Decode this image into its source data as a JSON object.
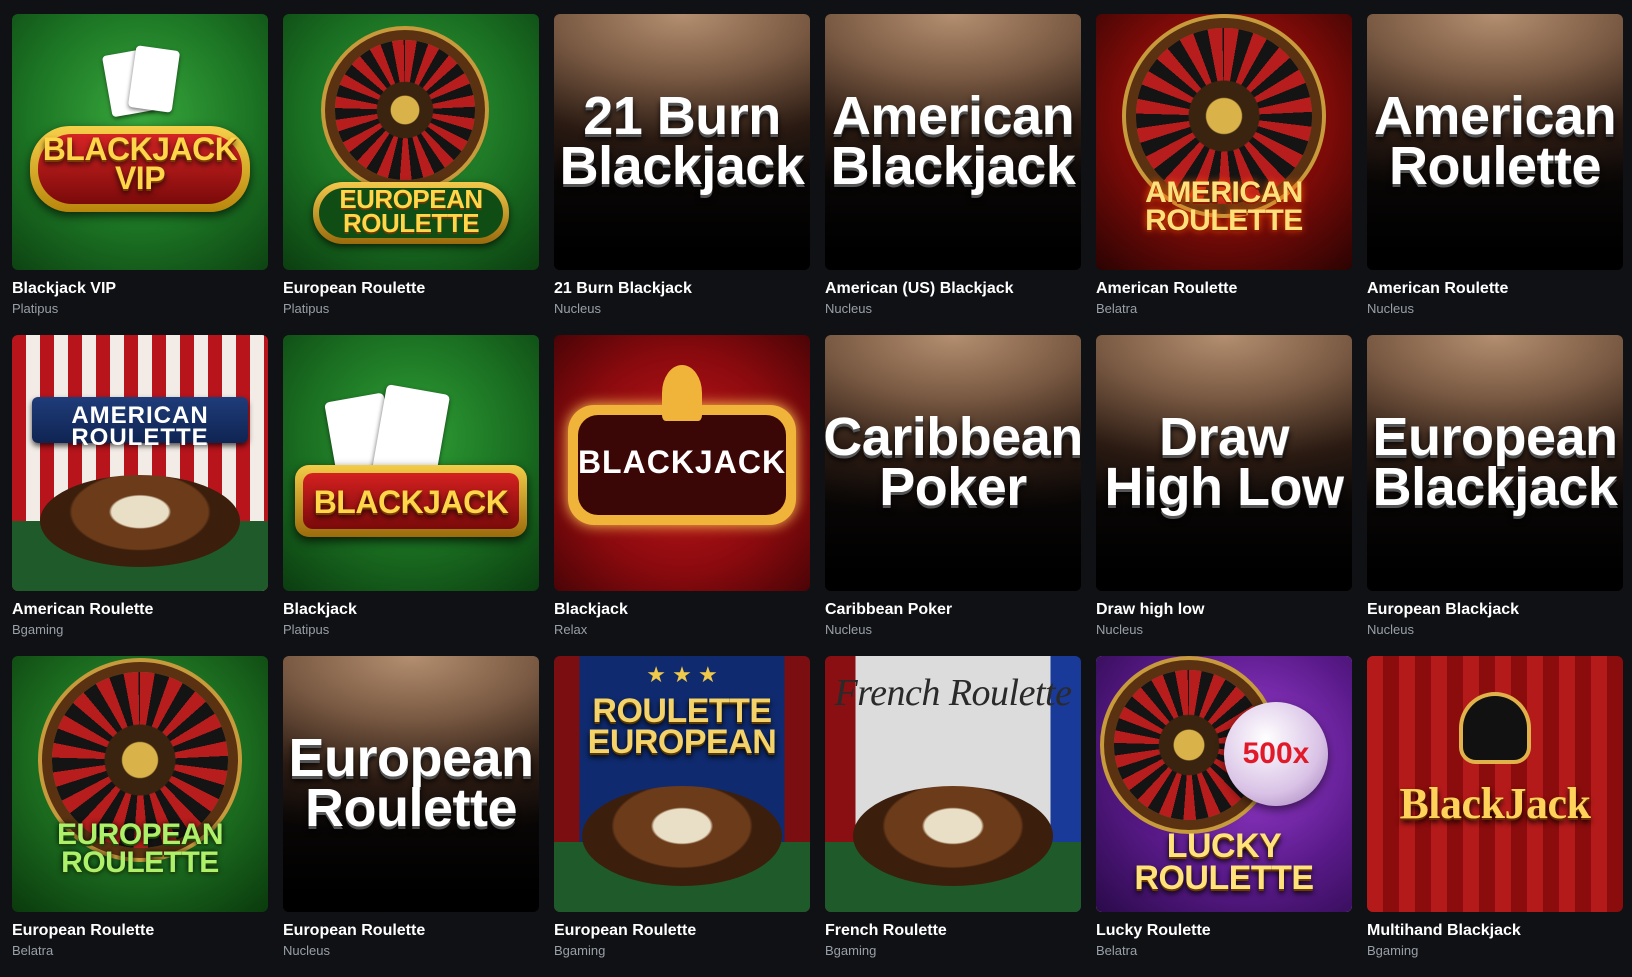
{
  "games": [
    {
      "title": "Blackjack VIP",
      "provider": "Platipus",
      "art": "BLACKJACK VIP"
    },
    {
      "title": "European Roulette",
      "provider": "Platipus",
      "art": "EUROPEAN ROULETTE"
    },
    {
      "title": "21 Burn Blackjack",
      "provider": "Nucleus",
      "art": "21 Burn Blackjack"
    },
    {
      "title": "American (US) Blackjack",
      "provider": "Nucleus",
      "art": "American Blackjack"
    },
    {
      "title": "American Roulette",
      "provider": "Belatra",
      "art": "AMERICAN ROULETTE"
    },
    {
      "title": "American Roulette",
      "provider": "Nucleus",
      "art": "American Roulette"
    },
    {
      "title": "American Roulette",
      "provider": "Bgaming",
      "art": "AMERICAN ROULETTE"
    },
    {
      "title": "Blackjack",
      "provider": "Platipus",
      "art": "BLACKJACK"
    },
    {
      "title": "Blackjack",
      "provider": "Relax",
      "art": "BLACKJACK"
    },
    {
      "title": "Caribbean Poker",
      "provider": "Nucleus",
      "art": "Caribbean Poker"
    },
    {
      "title": "Draw high low",
      "provider": "Nucleus",
      "art": "Draw High Low"
    },
    {
      "title": "European Blackjack",
      "provider": "Nucleus",
      "art": "European Blackjack"
    },
    {
      "title": "European Roulette",
      "provider": "Belatra",
      "art": "EUROPEAN ROULETTE"
    },
    {
      "title": "European Roulette",
      "provider": "Nucleus",
      "art": "European Roulette"
    },
    {
      "title": "European Roulette",
      "provider": "Bgaming",
      "art": "ROULETTE EUROPEAN"
    },
    {
      "title": "French Roulette",
      "provider": "Bgaming",
      "art": "French Roulette"
    },
    {
      "title": "Lucky Roulette",
      "provider": "Belatra",
      "art": "LUCKY ROULETTE",
      "badge": "500x"
    },
    {
      "title": "Multihand Blackjack",
      "provider": "Bgaming",
      "art": "BlackJack"
    }
  ]
}
